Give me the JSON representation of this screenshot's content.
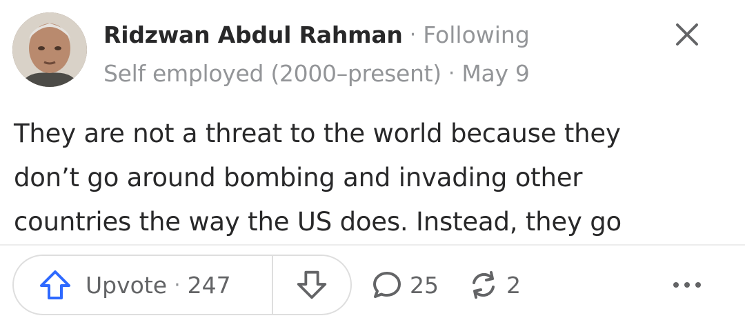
{
  "post": {
    "author": {
      "name": "Ridzwan Abdul Rahman",
      "follow_status": "Following",
      "credential": "Self employed (2000–present)",
      "date": "May 9",
      "separator": "·"
    },
    "body_lines": [
      "They are not a threat to the world because they",
      "don’t go around bombing and invading other",
      "countries the way the US does. Instead, they go"
    ]
  },
  "actions": {
    "upvote_label": "Upvote",
    "upvote_separator": "·",
    "upvote_count": "247",
    "comment_count": "25",
    "share_count": "2"
  },
  "icons": {
    "close": "close-icon",
    "upvote": "arrow-up-icon",
    "downvote": "arrow-down-icon",
    "comment": "comment-bubble-icon",
    "share": "share-cycle-icon",
    "more": "more-dots-icon"
  },
  "colors": {
    "text_primary": "#282829",
    "text_secondary": "#939598",
    "action_text": "#636466",
    "upvote_blue": "#2e69ff",
    "border": "#dedede"
  }
}
